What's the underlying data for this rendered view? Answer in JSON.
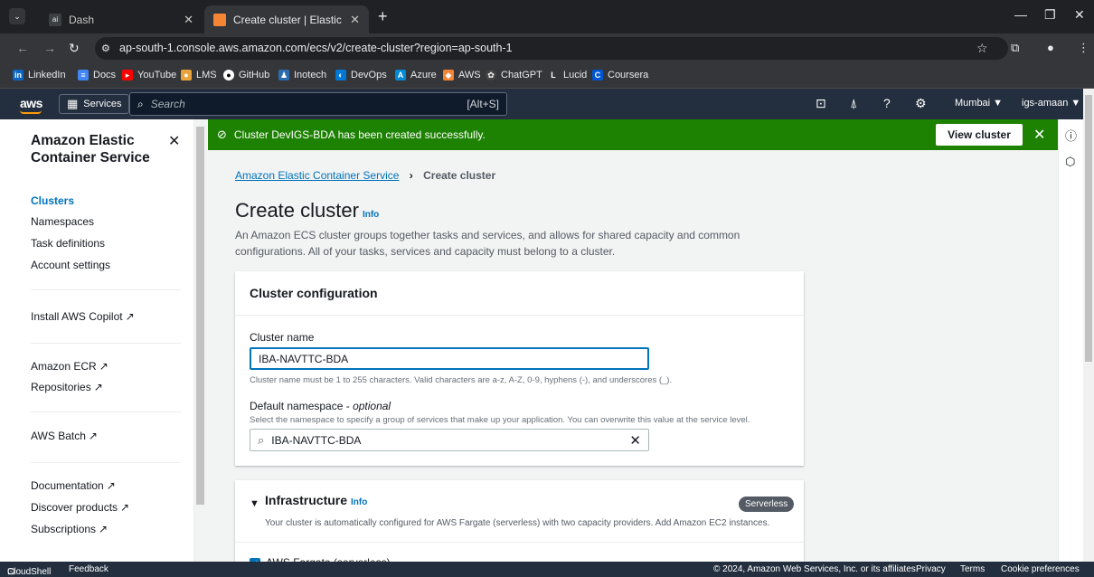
{
  "browser": {
    "tabs": [
      {
        "title": "Dash",
        "active": false
      },
      {
        "title": "Create cluster | Elastic Containe",
        "active": true
      }
    ],
    "url": "ap-south-1.console.aws.amazon.com/ecs/v2/create-cluster?region=ap-south-1",
    "bookmarks": [
      "LinkedIn",
      "Docs",
      "YouTube",
      "LMS",
      "GitHub",
      "Inotech",
      "DevOps",
      "Azure",
      "AWS",
      "ChatGPT",
      "Lucid",
      "Coursera"
    ]
  },
  "aws_nav": {
    "logo": "aws",
    "services_label": "Services",
    "search_placeholder": "Search",
    "search_shortcut": "[Alt+S]",
    "region": "Mumbai ▼",
    "account": "igs-amaan ▼"
  },
  "sidebar": {
    "title": "Amazon Elastic Container Service",
    "items": [
      {
        "label": "Clusters"
      },
      {
        "label": "Namespaces"
      },
      {
        "label": "Task definitions"
      },
      {
        "label": "Account settings"
      }
    ],
    "external_links": [
      "Install AWS Copilot",
      "Amazon ECR",
      "Repositories",
      "AWS Batch",
      "Documentation",
      "Discover products",
      "Subscriptions"
    ]
  },
  "flash": {
    "message": "Cluster DevIGS-BDA has been created successfully.",
    "button": "View cluster",
    "color": "#1d8102"
  },
  "breadcrumb": {
    "parent": "Amazon Elastic Container Service",
    "current": "Create cluster"
  },
  "page": {
    "title": "Create cluster",
    "info": "Info",
    "description": "An Amazon ECS cluster groups together tasks and services, and allows for shared capacity and common configurations. All of your tasks, services and capacity must belong to a cluster."
  },
  "cluster_config": {
    "heading": "Cluster configuration",
    "name_label": "Cluster name",
    "name_value": "IBA-NAVTTC-BDA",
    "name_hint": "Cluster name must be 1 to 255 characters. Valid characters are a-z, A-Z, 0-9, hyphens (-), and underscores (_).",
    "namespace_label": "Default namespace - ",
    "namespace_optional": "optional",
    "namespace_hint": "Select the namespace to specify a group of services that make up your application. You can overwrite this value at the service level.",
    "namespace_value": "IBA-NAVTTC-BDA"
  },
  "infrastructure": {
    "heading": "Infrastructure",
    "info": "Info",
    "badge": "Serverless",
    "description": "Your cluster is automatically configured for AWS Fargate (serverless) with two capacity providers. Add Amazon EC2 instances.",
    "fargate_label": "AWS Fargate (serverless)"
  },
  "footer": {
    "cloudshell": "CloudShell",
    "feedback": "Feedback",
    "copyright": "© 2024, Amazon Web Services, Inc. or its affiliates.",
    "privacy": "Privacy",
    "terms": "Terms",
    "cookie": "Cookie preferences"
  }
}
